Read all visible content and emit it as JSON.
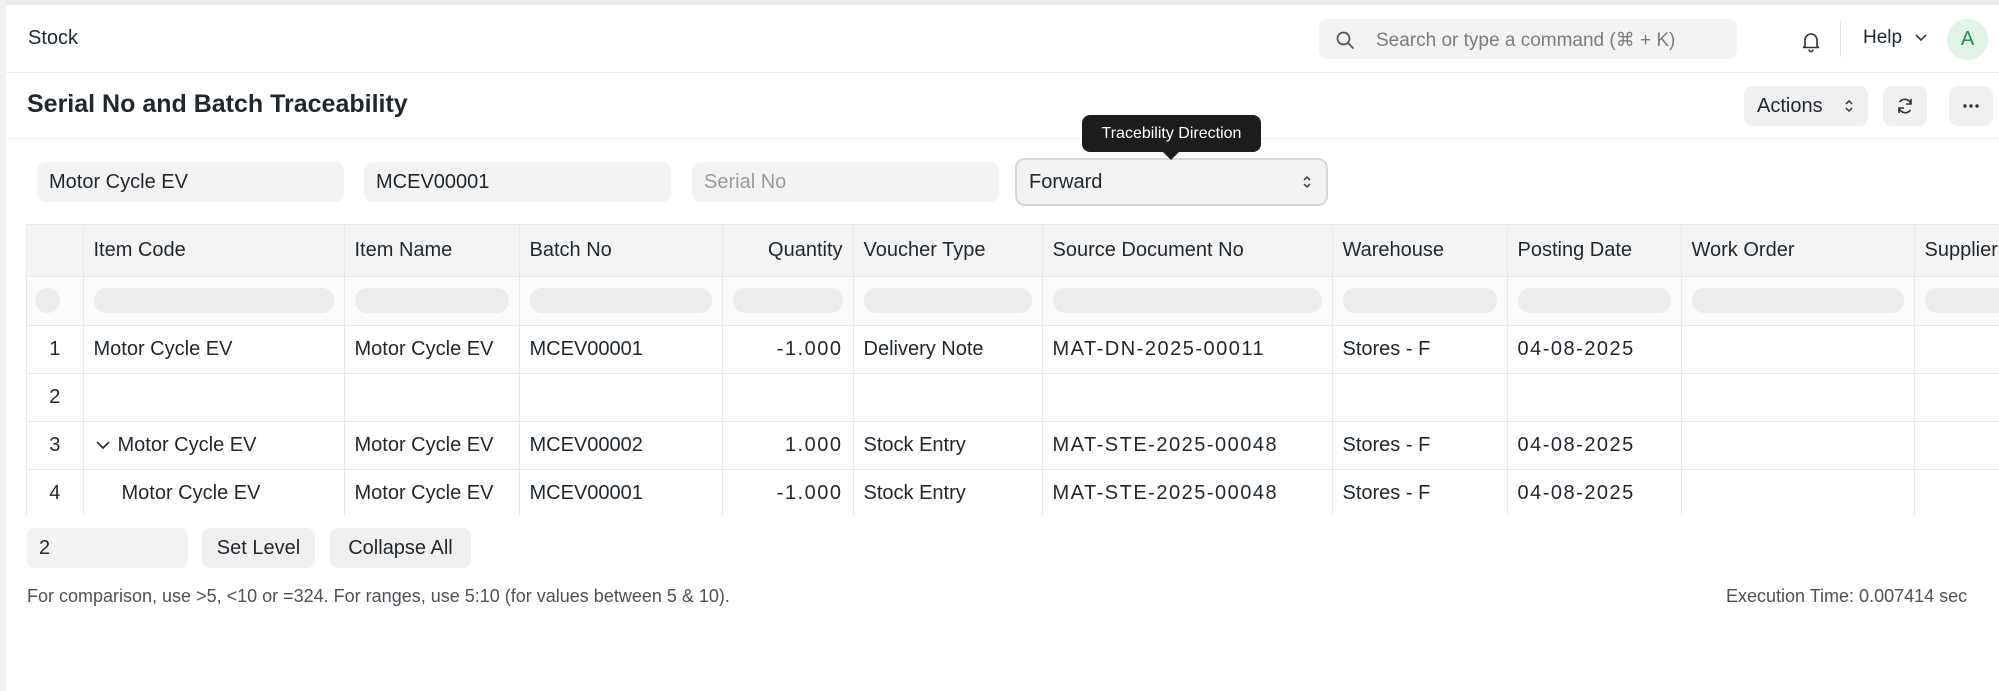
{
  "navbar": {
    "brand": "Stock",
    "search_placeholder": "Search or type a command (⌘ + K)",
    "help_label": "Help",
    "avatar_initial": "A"
  },
  "page": {
    "title": "Serial No and Batch Traceability",
    "actions_label": "Actions"
  },
  "filters": {
    "item": "Motor Cycle EV",
    "batch": "MCEV00001",
    "serial_placeholder": "Serial No",
    "direction": "Forward",
    "tooltip": "Tracebility Direction"
  },
  "table": {
    "columns": [
      "Item Code",
      "Item Name",
      "Batch No",
      "Quantity",
      "Voucher Type",
      "Source Document No",
      "Warehouse",
      "Posting Date",
      "Work Order",
      "Supplier"
    ],
    "rows": [
      {
        "idx": "1",
        "item_code": "Motor Cycle EV",
        "item_name": "Motor Cycle EV",
        "batch_no": "MCEV00001",
        "quantity": "-1.000",
        "voucher_type": "Delivery Note",
        "source_doc": "MAT-DN-2025-00011",
        "warehouse": "Stores - F",
        "posting_date": "04-08-2025",
        "work_order": "",
        "supplier": ""
      },
      {
        "idx": "2",
        "item_code": "",
        "item_name": "",
        "batch_no": "",
        "quantity": "",
        "voucher_type": "",
        "source_doc": "",
        "warehouse": "",
        "posting_date": "",
        "work_order": "",
        "supplier": ""
      },
      {
        "idx": "3",
        "item_code": "Motor Cycle EV",
        "item_name": "Motor Cycle EV",
        "batch_no": "MCEV00002",
        "quantity": "1.000",
        "voucher_type": "Stock Entry",
        "source_doc": "MAT-STE-2025-00048",
        "warehouse": "Stores - F",
        "posting_date": "04-08-2025",
        "work_order": "",
        "supplier": ""
      },
      {
        "idx": "4",
        "item_code": "Motor Cycle EV",
        "item_name": "Motor Cycle EV",
        "batch_no": "MCEV00001",
        "quantity": "-1.000",
        "voucher_type": "Stock Entry",
        "source_doc": "MAT-STE-2025-00048",
        "warehouse": "Stores - F",
        "posting_date": "04-08-2025",
        "work_order": "",
        "supplier": ""
      }
    ]
  },
  "footer": {
    "level_value": "2",
    "set_level_label": "Set Level",
    "collapse_all_label": "Collapse All",
    "note": "For comparison, use >5, <10 or =324. For ranges, use 5:10 (for values between 5 & 10).",
    "execution_time": "Execution Time: 0.007414 sec"
  },
  "colors": {
    "accent_red": "#e03636",
    "avatar_bg": "#dff3e7",
    "avatar_fg": "#2a8a55"
  },
  "icons": [
    "search-icon",
    "bell-icon",
    "chevron-down-icon",
    "updown-icon",
    "refresh-icon",
    "more-icon",
    "caret-down-icon"
  ]
}
